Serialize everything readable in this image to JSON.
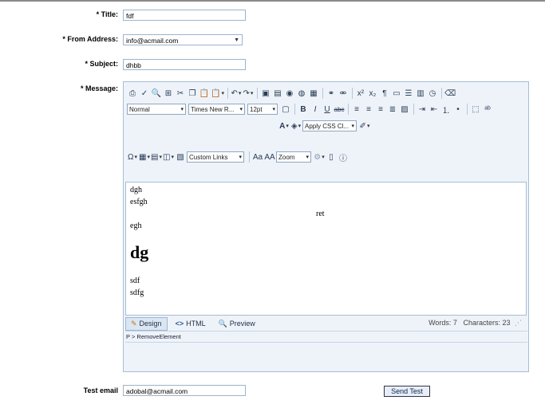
{
  "form": {
    "title_label": "* Title:",
    "title_value": "fdf",
    "from_label": "* From Address:",
    "from_value": "info@acmail.com",
    "subject_label": "* Subject:",
    "subject_value": "dhbb",
    "message_label": "* Message:",
    "test_label": "Test email",
    "test_value": "adobal@acmail.com",
    "send_label": "Send Test"
  },
  "toolbar": {
    "paragraph_style": "Normal",
    "font_name": "Times New R...",
    "font_size": "12pt",
    "css_class": "Apply CSS Cl...",
    "links": "Custom Links",
    "zoom": "Zoom"
  },
  "content": {
    "lines": [
      "dgh",
      "esfgh",
      "ret",
      "egh",
      "dg",
      "sdf",
      "sdfg"
    ]
  },
  "modes": {
    "design": "Design",
    "html": "HTML",
    "preview": "Preview"
  },
  "stats": {
    "words": "Words: 7",
    "characters": "Characters: 23"
  },
  "path": "P > RemoveElement"
}
